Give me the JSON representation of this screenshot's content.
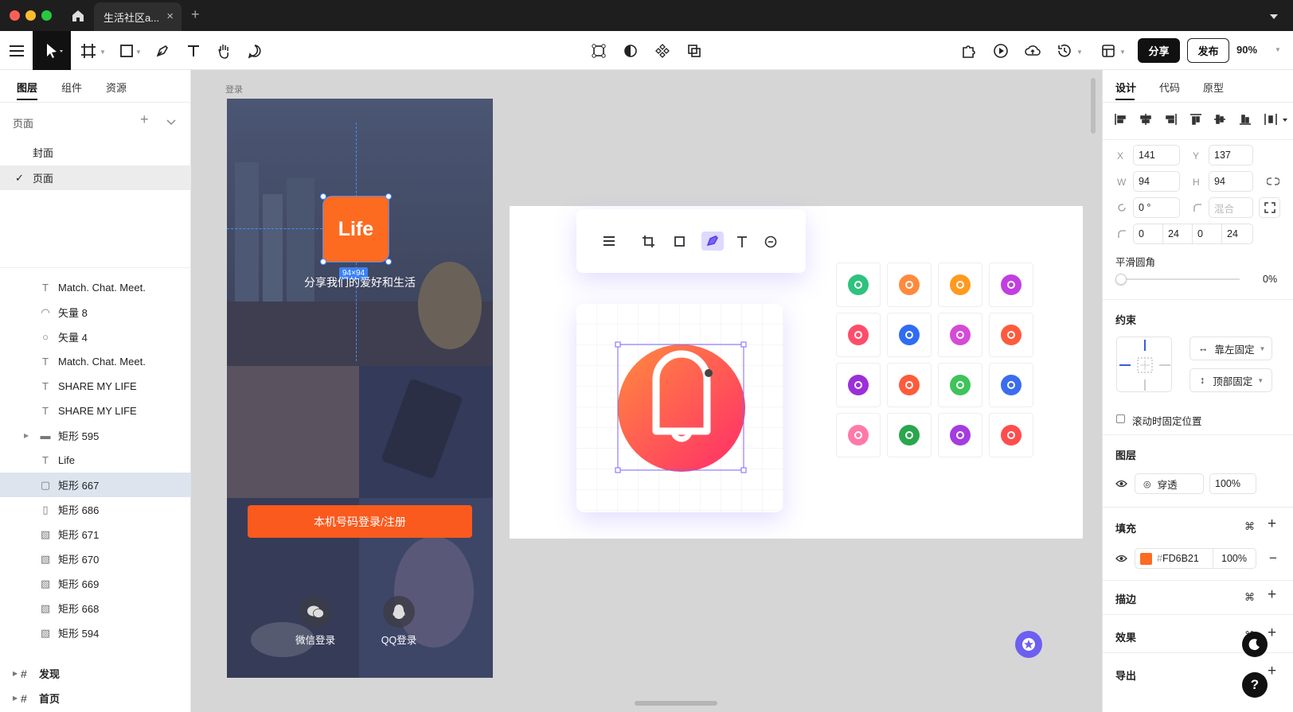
{
  "window": {
    "tab_title": "生活社区a...",
    "tab_close": "×",
    "new_tab": "+"
  },
  "toolbar": {
    "share_label": "分享",
    "publish_label": "发布",
    "zoom": "90%"
  },
  "left_panel": {
    "tabs": [
      "图层",
      "组件",
      "资源"
    ],
    "pages_title": "页面",
    "pages": [
      "封面",
      "页面"
    ],
    "check": "✓",
    "layers": [
      {
        "icon": "T",
        "label": "Match. Chat. Meet."
      },
      {
        "icon": "◠",
        "label": "矢量 8"
      },
      {
        "icon": "○",
        "label": "矢量 4"
      },
      {
        "icon": "T",
        "label": "Match. Chat. Meet."
      },
      {
        "icon": "T",
        "label": "SHARE MY LIFE"
      },
      {
        "icon": "T",
        "label": "SHARE MY LIFE"
      },
      {
        "icon": "▬",
        "label": "矩形 595"
      },
      {
        "icon": "T",
        "label": "Life"
      },
      {
        "icon": "▢",
        "label": "矩形 667"
      },
      {
        "icon": "▯",
        "label": "矩形 686"
      },
      {
        "icon": "▧",
        "label": "矩形 671"
      },
      {
        "icon": "▧",
        "label": "矩形 670"
      },
      {
        "icon": "▧",
        "label": "矩形 669"
      },
      {
        "icon": "▧",
        "label": "矩形 668"
      },
      {
        "icon": "▧",
        "label": "矩形 594"
      }
    ],
    "frames": [
      "发现",
      "首页"
    ]
  },
  "canvas": {
    "frame_label": "登录",
    "logo_text": "Life",
    "size_badge": "94×94",
    "slogan": "分享我们的爱好和生活",
    "login_button": "本机号码登录/注册",
    "wechat_login": "微信登录",
    "qq_login": "QQ登录",
    "icon_colors": [
      [
        "#2ec27e",
        "#ff8a3d",
        "#ff9a1f",
        "#c13fe0"
      ],
      [
        "#ff4d6a",
        "#2f6cf5",
        "#d54ad7",
        "#ff5a3c"
      ],
      [
        "#9b2fd8",
        "#ff5a3c",
        "#3ec45a",
        "#3b6cf0"
      ],
      [
        "#ff7aa8",
        "#2aa64e",
        "#a43ce0",
        "#ff4d4d"
      ]
    ]
  },
  "right_panel": {
    "tabs": [
      "设计",
      "代码",
      "原型"
    ],
    "x_label": "X",
    "x": "141",
    "y_label": "Y",
    "y": "137",
    "w_label": "W",
    "w": "94",
    "h_label": "H",
    "h": "94",
    "rotation": "0 °",
    "blend_placeholder": "混合",
    "radius": [
      "0",
      "24",
      "0",
      "24"
    ],
    "smooth_title": "平滑圆角",
    "smooth_value": "0%",
    "constraints_title": "约束",
    "constraint_h": "靠左固定",
    "constraint_v": "顶部固定",
    "fix_on_scroll": "滚动时固定位置",
    "layer_title": "图层",
    "blend_mode": "穿透",
    "opacity": "100%",
    "fill_title": "填充",
    "fill_hex_prefix": "#",
    "fill_hex": "FD6B21",
    "fill_opacity": "100%",
    "fill_color": "#fd6b21",
    "stroke_title": "描边",
    "effect_title": "效果",
    "export_title": "导出",
    "help": "?"
  }
}
